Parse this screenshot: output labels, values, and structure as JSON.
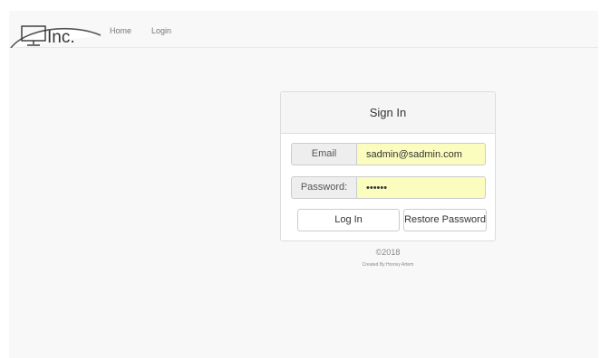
{
  "navbar": {
    "logo_text": "Inc.",
    "links": [
      {
        "label": "Home"
      },
      {
        "label": "Login"
      }
    ]
  },
  "signin": {
    "title": "Sign In",
    "email_label": "Email",
    "email_value": "sadmin@sadmin.com",
    "password_label": "Password:",
    "password_value": "......",
    "login_button": "Log In",
    "restore_button": "Restore Password"
  },
  "footer": {
    "copyright": "©2018",
    "credit": "Created By Horovy Artem"
  },
  "colors": {
    "autofill": "#fafdbe",
    "background": "#f8f8f8"
  },
  "icons": {
    "logo": "monitor-icon"
  }
}
